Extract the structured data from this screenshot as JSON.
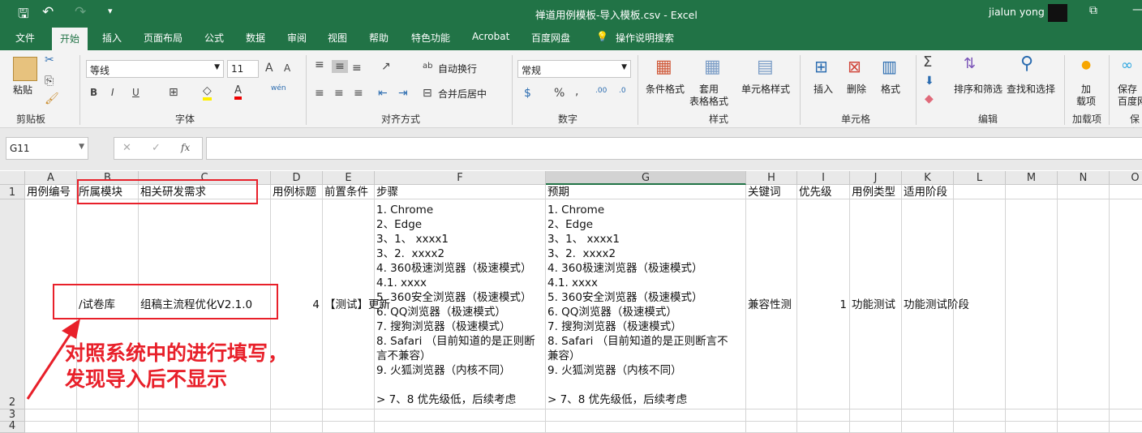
{
  "title_bar": {
    "title": "禅道用例模板-导入模板.csv  -  Excel",
    "user": "jialun yong",
    "undo_label": "↶",
    "redo_label": "↷",
    "restore": "⧉",
    "minimize": "—"
  },
  "tabs": [
    "文件",
    "开始",
    "插入",
    "页面布局",
    "公式",
    "数据",
    "审阅",
    "视图",
    "帮助",
    "特色功能",
    "Acrobat",
    "百度网盘",
    "操作说明搜索"
  ],
  "ribbon": {
    "clipboard": {
      "paste": "粘贴",
      "group": "剪贴板"
    },
    "font": {
      "name": "等线",
      "size": "11",
      "bold": "B",
      "italic": "I",
      "underline": "U",
      "group": "字体",
      "grow": "A",
      "shrink": "A",
      "phonetic": "wén"
    },
    "alignment": {
      "wrap": "自动换行",
      "merge": "合并后居中",
      "group": "对齐方式"
    },
    "number": {
      "format": "常规",
      "percent": "%",
      "comma": ",",
      "inc": ".00",
      "dec": ".0",
      "group": "数字"
    },
    "styles": {
      "conditional": "条件格式",
      "table": "套用\n表格格式",
      "cell_styles": "单元格样式",
      "group": "样式"
    },
    "cells": {
      "insert": "插入",
      "delete": "删除",
      "format": "格式",
      "group": "单元格"
    },
    "editing": {
      "sum": "Σ",
      "sort": "排序和筛选",
      "find": "查找和选择",
      "group": "编辑"
    },
    "addins": {
      "load": "加\n载项",
      "group": "加载项"
    },
    "baidu": {
      "save": "保存\n百度网",
      "group": "保存"
    }
  },
  "formula_bar": {
    "name_box": "G11",
    "cancel": "✕",
    "enter": "✓",
    "fx": "fx",
    "value": ""
  },
  "columns": [
    "A",
    "B",
    "C",
    "D",
    "E",
    "F",
    "G",
    "H",
    "I",
    "J",
    "K",
    "L",
    "M",
    "N",
    "O"
  ],
  "rows": [
    "1",
    "2",
    "3",
    "4"
  ],
  "row1": [
    "用例编号",
    "所属模块",
    "相关研发需求",
    "用例标题",
    "前置条件",
    "步骤",
    "预期",
    "关键词",
    "优先级",
    "用例类型",
    "适用阶段"
  ],
  "row2": {
    "B": "/试卷库",
    "C": "组稿主流程优化V2.1.0",
    "D": "4",
    "E": "【测试】更新",
    "F": "1. Chrome\n2、Edge\n3、1、 xxxx1\n3、2.  xxxx2\n4. 360极速浏览器（极速模式）\n4.1. xxxx\n5. 360安全浏览器（极速模式）\n6. QQ浏览器（极速模式）\n7. 搜狗浏览器（极速模式）\n8. Safari （目前知道的是正则断\n言不兼容）\n9. 火狐浏览器（内核不同）\n\n> 7、8 优先级低，后续考虑",
    "G": "1. Chrome\n2、Edge\n3、1、 xxxx1\n3、2.  xxxx2\n4. 360极速浏览器（极速模式）\n4.1. xxxx\n5. 360安全浏览器（极速模式）\n6. QQ浏览器（极速模式）\n7. 搜狗浏览器（极速模式）\n8. Safari （目前知道的是正则断言不\n兼容）\n9. 火狐浏览器（内核不同）\n\n> 7、8 优先级低，后续考虑",
    "H": "兼容性测",
    "I": "1",
    "J": "功能测试",
    "K": "功能测试阶段"
  },
  "annotation": {
    "line1": "对照系统中的进行填写，",
    "line2": "发现导入后不显示"
  },
  "colors": {
    "excel_green": "#217346",
    "annotation_red": "#e8202a"
  }
}
